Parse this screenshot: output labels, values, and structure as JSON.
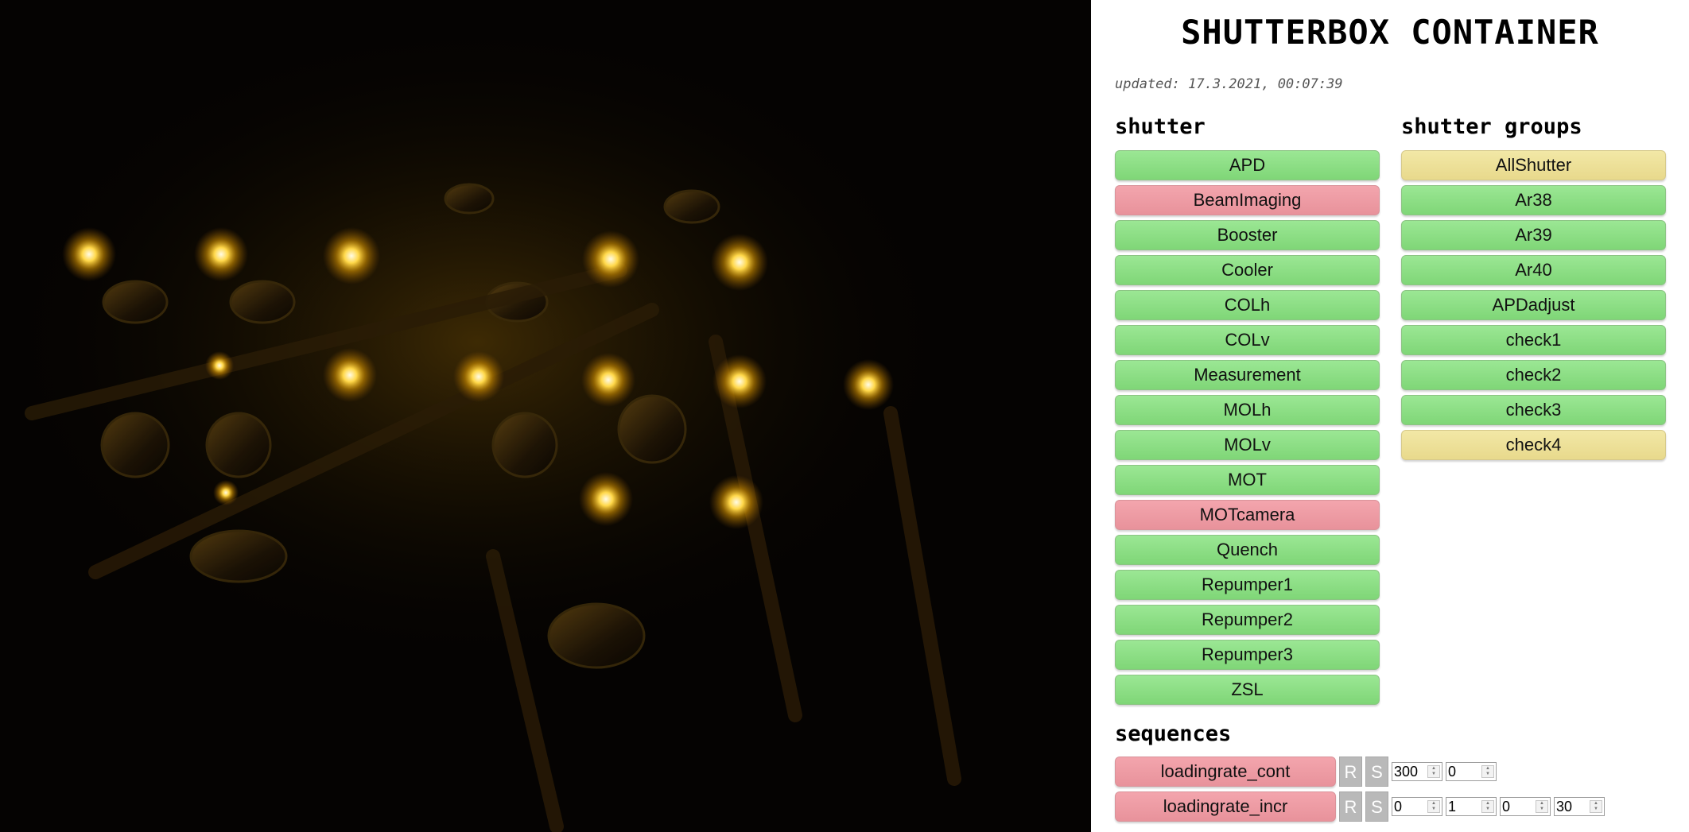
{
  "header": {
    "title": "SHUTTERBOX CONTAINER",
    "updated": "updated: 17.3.2021, 00:07:39"
  },
  "camera": {
    "description_icon": "camera-feed"
  },
  "shutter": {
    "title": "shutter",
    "items": [
      {
        "label": "APD",
        "state": "green"
      },
      {
        "label": "BeamImaging",
        "state": "red"
      },
      {
        "label": "Booster",
        "state": "green"
      },
      {
        "label": "Cooler",
        "state": "green"
      },
      {
        "label": "COLh",
        "state": "green"
      },
      {
        "label": "COLv",
        "state": "green"
      },
      {
        "label": "Measurement",
        "state": "green"
      },
      {
        "label": "MOLh",
        "state": "green"
      },
      {
        "label": "MOLv",
        "state": "green"
      },
      {
        "label": "MOT",
        "state": "green"
      },
      {
        "label": "MOTcamera",
        "state": "red"
      },
      {
        "label": "Quench",
        "state": "green"
      },
      {
        "label": "Repumper1",
        "state": "green"
      },
      {
        "label": "Repumper2",
        "state": "green"
      },
      {
        "label": "Repumper3",
        "state": "green"
      },
      {
        "label": "ZSL",
        "state": "green"
      }
    ]
  },
  "groups": {
    "title": "shutter groups",
    "items": [
      {
        "label": "AllShutter",
        "state": "yellow"
      },
      {
        "label": "Ar38",
        "state": "green"
      },
      {
        "label": "Ar39",
        "state": "green"
      },
      {
        "label": "Ar40",
        "state": "green"
      },
      {
        "label": "APDadjust",
        "state": "green"
      },
      {
        "label": "check1",
        "state": "green"
      },
      {
        "label": "check2",
        "state": "green"
      },
      {
        "label": "check3",
        "state": "green"
      },
      {
        "label": "check4",
        "state": "yellow"
      }
    ]
  },
  "sequences": {
    "title": "sequences",
    "rows": [
      {
        "label": "loadingrate_cont",
        "state": "red",
        "r": "R",
        "s": "S",
        "values": [
          "300",
          "0"
        ]
      },
      {
        "label": "loadingrate_incr",
        "state": "red",
        "r": "R",
        "s": "S",
        "values": [
          "0",
          "1",
          "0",
          "30"
        ]
      }
    ]
  },
  "colors": {
    "green": "#8fe087",
    "red": "#ee9ba3",
    "yellow": "#eee09a",
    "led": "#ffc21a"
  }
}
